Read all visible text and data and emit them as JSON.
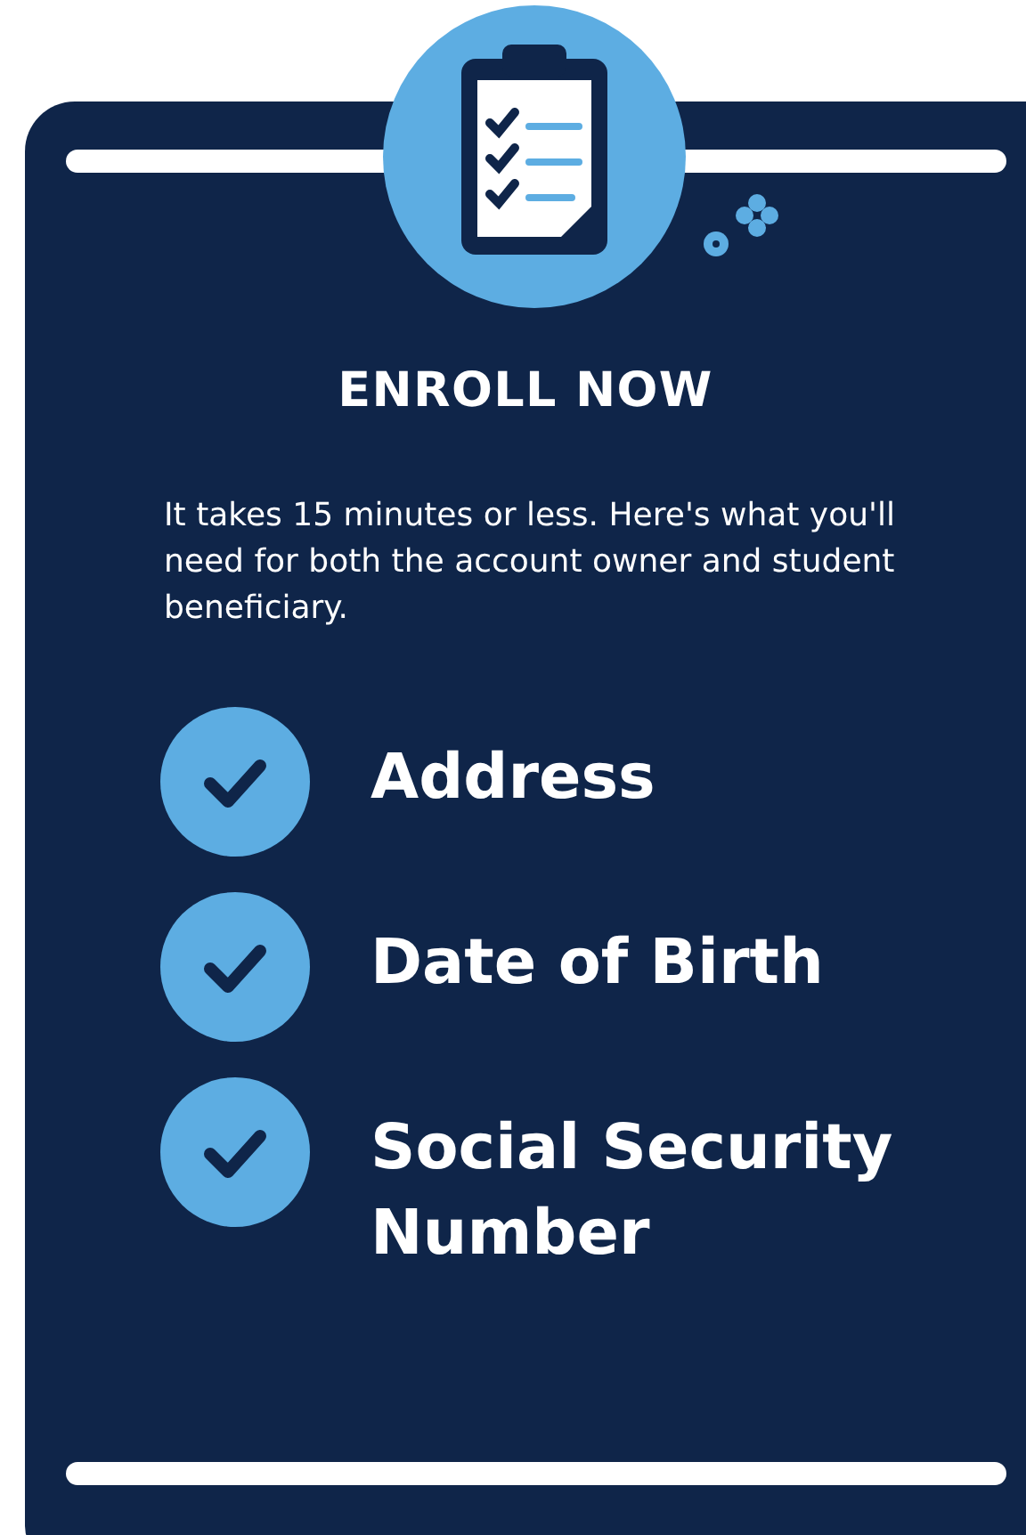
{
  "title": "ENROLL NOW",
  "description": "It takes 15 minutes or less. Here's what you'll need for both the account owner and student beneficiary.",
  "items": [
    {
      "label": "Address"
    },
    {
      "label": "Date of Birth"
    },
    {
      "label": "Social Security Number"
    }
  ]
}
